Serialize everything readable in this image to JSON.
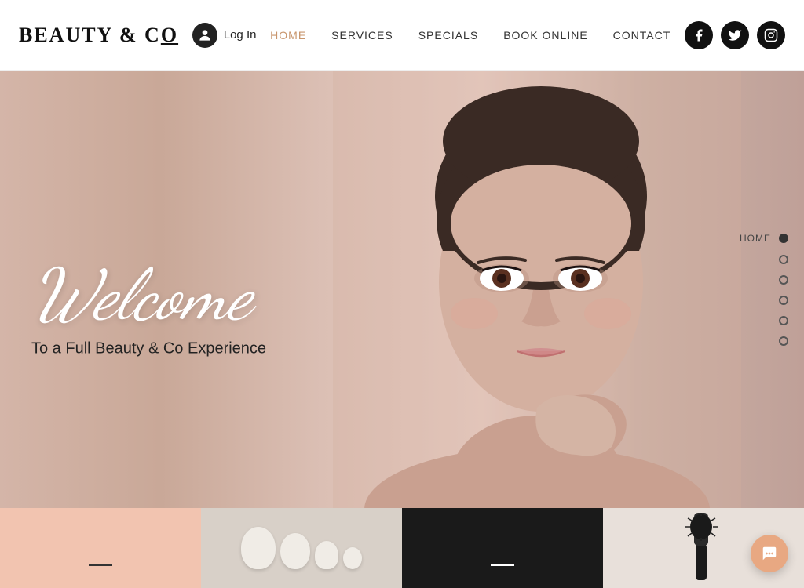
{
  "header": {
    "logo": "BEAUTY & C",
    "logo_o": "o",
    "login_label": "Log In",
    "nav_items": [
      {
        "id": "home",
        "label": "HOME",
        "active": true
      },
      {
        "id": "services",
        "label": "SERVICES",
        "active": false
      },
      {
        "id": "specials",
        "label": "SPECIALS",
        "active": false
      },
      {
        "id": "book_online",
        "label": "BOOK ONLINE",
        "active": false
      },
      {
        "id": "contact",
        "label": "CONTACT",
        "active": false
      }
    ],
    "social": [
      {
        "id": "facebook",
        "symbol": "f"
      },
      {
        "id": "twitter",
        "symbol": "t"
      },
      {
        "id": "instagram",
        "symbol": "in"
      }
    ]
  },
  "hero": {
    "welcome_text": "Welcome",
    "subtitle": "To a Full Beauty & Co Experience"
  },
  "side_nav": {
    "items": [
      {
        "id": "home",
        "label": "HOME",
        "active": true
      },
      {
        "id": "slide2",
        "label": "",
        "active": false
      },
      {
        "id": "slide3",
        "label": "",
        "active": false
      },
      {
        "id": "slide4",
        "label": "",
        "active": false
      },
      {
        "id": "slide5",
        "label": "",
        "active": false
      },
      {
        "id": "slide6",
        "label": "",
        "active": false
      }
    ]
  },
  "chat": {
    "symbol": "···"
  }
}
